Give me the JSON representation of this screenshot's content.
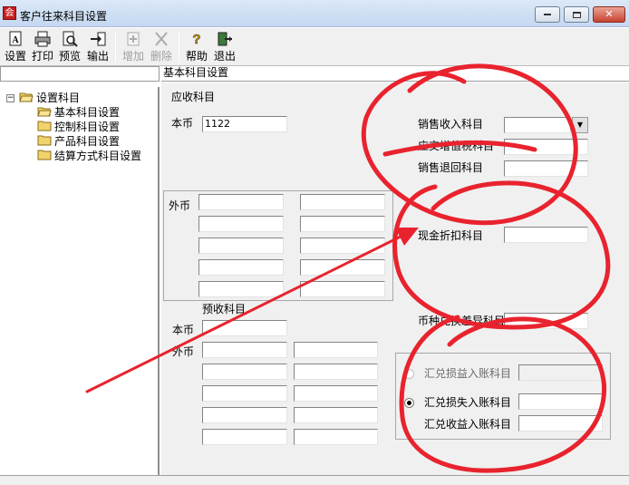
{
  "window": {
    "title": "客户往来科目设置",
    "app_icon_glyph": "会"
  },
  "toolbar": {
    "buttons": [
      {
        "id": "setup",
        "label": "设置",
        "icon": "setup-icon"
      },
      {
        "id": "print",
        "label": "打印",
        "icon": "printer-icon"
      },
      {
        "id": "preview",
        "label": "预览",
        "icon": "preview-icon"
      },
      {
        "id": "export",
        "label": "输出",
        "icon": "export-icon"
      },
      {
        "id": "add",
        "label": "增加",
        "icon": "add-icon",
        "disabled": true
      },
      {
        "id": "delete",
        "label": "删除",
        "icon": "delete-icon",
        "disabled": true
      },
      {
        "id": "help",
        "label": "帮助",
        "icon": "help-icon"
      },
      {
        "id": "exit",
        "label": "退出",
        "icon": "exit-icon"
      }
    ]
  },
  "panel": {
    "right_header": "基本科目设置"
  },
  "tree": {
    "root": "设置科目",
    "root_expander": "−",
    "items": [
      "基本科目设置",
      "控制科目设置",
      "产品科目设置",
      "结算方式科目设置"
    ]
  },
  "receivable": {
    "title": "应收科目",
    "base_currency_label": "本币",
    "base_currency_value": "1122",
    "foreign_currency_label": "外币"
  },
  "right_fields": {
    "sales_income": "销售收入科目",
    "vat_output": "应交增值税科目",
    "sales_return": "销售退回科目",
    "cash_discount": "现金折扣科目",
    "currency_precision": "币种兑换差异科目",
    "dropdown_glyph": "▼"
  },
  "advance": {
    "title": "预收科目",
    "base_currency_label": "本币",
    "foreign_currency_label": "外币"
  },
  "exchange": {
    "gain_loss": "汇兑损益入账科目",
    "loss": "汇兑损失入账科目",
    "gain": "汇兑收益入账科目"
  },
  "colors": {
    "annotation_red": "#e8232e",
    "title_bar": "#c4d8f1",
    "folder_yellow": "#f2d36b"
  }
}
